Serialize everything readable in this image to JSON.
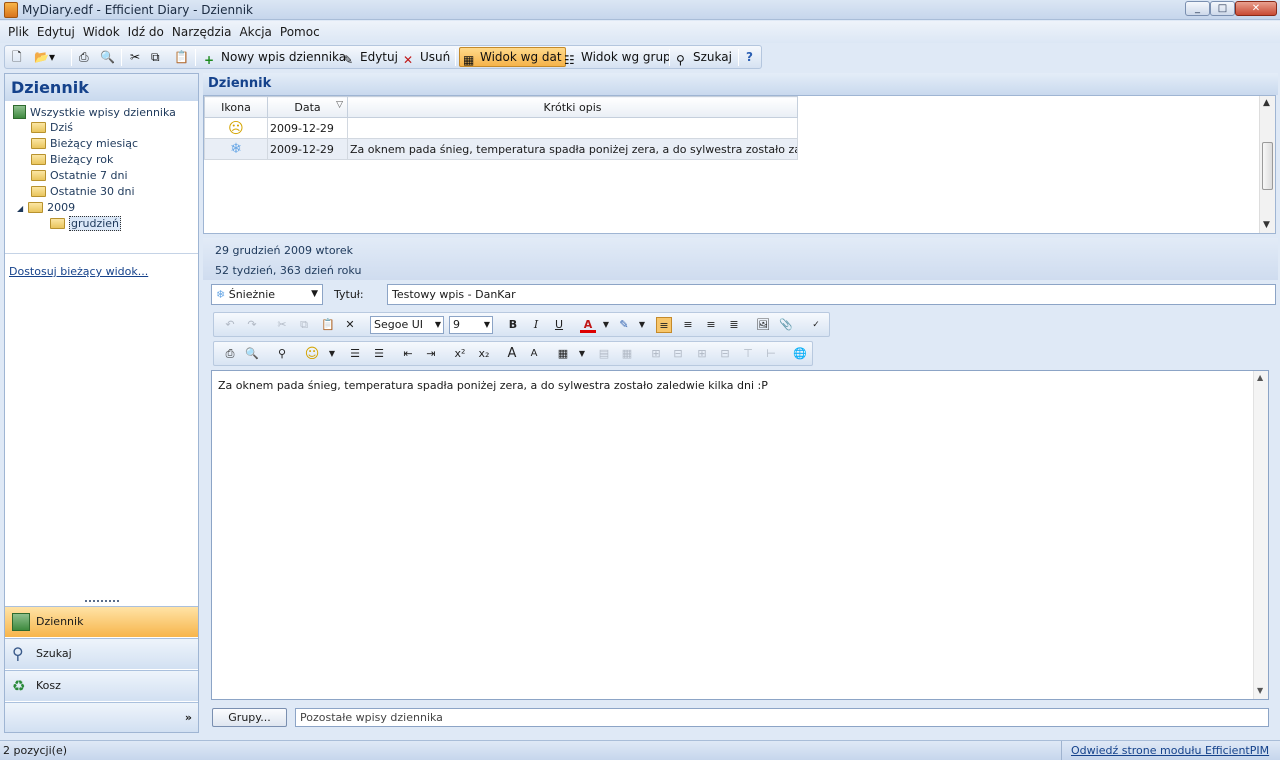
{
  "window": {
    "title": "MyDiary.edf - Efficient Diary - Dziennik",
    "min": "_",
    "max": "□",
    "close": "✕"
  },
  "menu": [
    "Plik",
    "Edytuj",
    "Widok",
    "Idź do",
    "Narzędzia",
    "Akcja",
    "Pomoc"
  ],
  "toolbar": {
    "new_entry": "Nowy wpis dziennika",
    "edit": "Edytuj",
    "delete": "Usuń",
    "view_dates": "Widok wg dat",
    "view_groups": "Widok wg grup",
    "search": "Szukaj"
  },
  "left": {
    "title": "Dziennik",
    "tree": [
      "Wszystkie wpisy dziennika",
      "Dziś",
      "Bieżący miesiąc",
      "Bieżący rok",
      "Ostatnie 7 dni",
      "Ostatnie 30 dni",
      "2009",
      "grudzień"
    ],
    "customize": "Dostosuj bieżący widok...",
    "nav": [
      "Dziennik",
      "Szukaj",
      "Kosz"
    ]
  },
  "main": {
    "title": "Dziennik",
    "columns": [
      "Ikona",
      "Data",
      "Krótki opis"
    ],
    "rows": [
      {
        "icon": "sad-face-icon",
        "date": "2009-12-29",
        "desc": ""
      },
      {
        "icon": "snowflake-icon",
        "date": "2009-12-29",
        "desc": "Za oknem pada śnieg, temperatura spadła poniżej zera, a do sylwestra zostało zaledw"
      }
    ]
  },
  "info": {
    "date": "29 grudzień 2009 wtorek",
    "week": "52 tydzień,  363 dzień roku"
  },
  "editor": {
    "mood": "Śnieżnie",
    "title_label": "Tytuł:",
    "title_value": "Testowy wpis - DanKar",
    "font": "Segoe UI",
    "size": "9",
    "body": "Za oknem pada śnieg, temperatura spadła poniżej zera, a do sylwestra zostało zaledwie kilka dni :P",
    "groups_button": "Grupy...",
    "groups_value": "Pozostałe wpisy dziennika"
  },
  "status": {
    "count": "2 pozycji(e)",
    "link": "Odwiedź strone modułu EfficientPIM"
  },
  "colors": {
    "accent": "#15428b",
    "selected_nav": "#f7b54b"
  }
}
